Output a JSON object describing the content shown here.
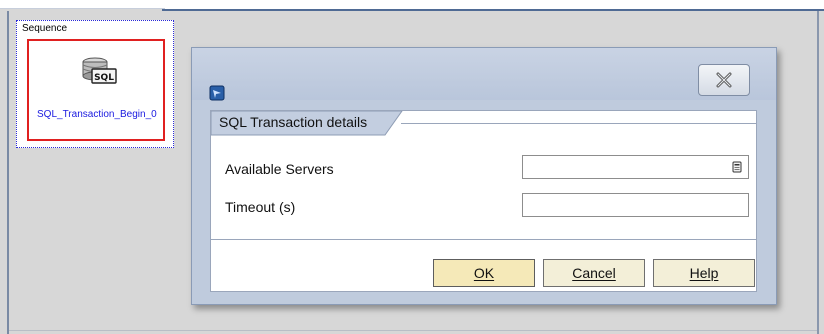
{
  "workspace": {
    "sequence_label": "Sequence",
    "activity_name": "SQL_Transaction_Begin_0",
    "activity_icon": "sql-database-icon",
    "activity_icon_text": "SQL"
  },
  "dialog": {
    "app_icon": "app-window-icon",
    "close_icon": "close-x-icon",
    "section_title": "SQL Transaction details",
    "fields": {
      "servers_label": "Available Servers",
      "servers_value": "",
      "timeout_label": "Timeout (s)",
      "timeout_value": ""
    },
    "buttons": {
      "ok": "OK",
      "cancel": "Cancel",
      "help": "Help"
    }
  },
  "colors": {
    "selection_border": "#e02020",
    "sequence_border": "#2a2ad8",
    "activity_text": "#1a1ae0",
    "dialog_background": "#bfcbdd"
  }
}
